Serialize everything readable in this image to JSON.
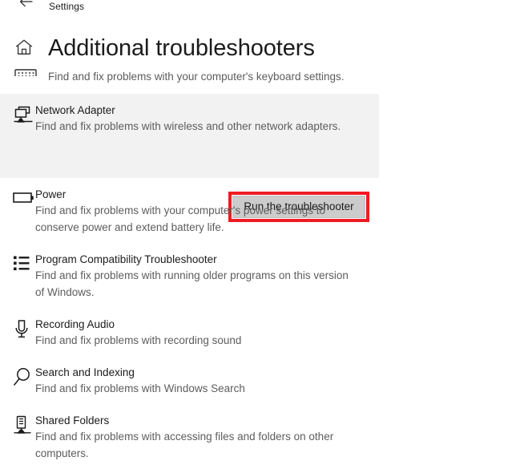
{
  "topbar": {
    "back_icon": "back-arrow-icon",
    "title": "Settings"
  },
  "header": {
    "home_icon": "home-icon",
    "keyboard_icon": "keyboard-icon",
    "title": "Additional troubleshooters",
    "subtitle": "Find and fix problems with your computer's keyboard settings."
  },
  "colors": {
    "highlight_red": "#ee1c22",
    "selected_row_bg": "#f2f2f2",
    "button_bg": "#cccccc",
    "title_text": "#1b1b1b",
    "desc_text": "#5d5d5d"
  },
  "troubleshooters": [
    {
      "icon": "network-adapter-icon",
      "title": "Network Adapter",
      "desc": "Find and fix problems with wireless and other network adapters.",
      "selected": true,
      "action_label": "Run the troubleshooter"
    },
    {
      "icon": "battery-icon",
      "title": "Power",
      "desc": "Find and fix problems with your computer's power settings to conserve power and extend battery life.",
      "selected": false
    },
    {
      "icon": "program-list-icon",
      "title": "Program Compatibility Troubleshooter",
      "desc": "Find and fix problems with running older programs on this version of Windows.",
      "selected": false
    },
    {
      "icon": "microphone-icon",
      "title": "Recording Audio",
      "desc": "Find and fix problems with recording sound",
      "selected": false
    },
    {
      "icon": "search-icon",
      "title": "Search and Indexing",
      "desc": "Find and fix problems with Windows Search",
      "selected": false
    },
    {
      "icon": "shared-folders-icon",
      "title": "Shared Folders",
      "desc": "Find and fix problems with accessing files and folders on other computers.",
      "selected": false
    }
  ]
}
